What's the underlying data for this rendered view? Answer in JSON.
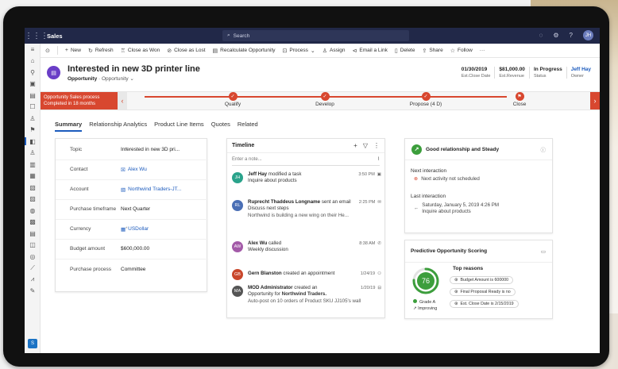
{
  "topbar": {
    "app_name": "Sales",
    "search_placeholder": "Search",
    "avatar_initials": "JH"
  },
  "command_bar": {
    "new": "New",
    "refresh": "Refresh",
    "close_won": "Close as Won",
    "close_lost": "Close as Lost",
    "recalculate": "Recalculate Opportunity",
    "process": "Process",
    "assign": "Assign",
    "email_link": "Email a Link",
    "delete": "Delete",
    "share": "Share",
    "follow": "Follow",
    "more": "···"
  },
  "record": {
    "title": "Interested in new 3D printer line",
    "entity": "Opportunity",
    "form": "Opportunity",
    "close_date": "01/30/2019",
    "close_date_label": "Est.Close Date",
    "revenue": "$81,000.00",
    "revenue_label": "Est.Revenue",
    "status": "In Progress",
    "status_label": "Status",
    "owner": "Jeff Hay",
    "owner_label": "Owner"
  },
  "process": {
    "name": "Opportunity Sales process",
    "completed": "Completed in 18 months",
    "stages": [
      "Qualify",
      "Develop",
      "Propose (4 D)",
      "Close"
    ]
  },
  "tabs": [
    "Summary",
    "Relationship Analytics",
    "Product Line Items",
    "Quotes",
    "Related"
  ],
  "summary": {
    "fields": [
      {
        "label": "Topic",
        "value": "Interested in new 3D pri..."
      },
      {
        "label": "Contact",
        "value": "Alex Wu"
      },
      {
        "label": "Account",
        "value": "Northwind Traders-JT..."
      },
      {
        "label": "Purchase timeframe",
        "value": "Next Quarter"
      },
      {
        "label": "Currency",
        "value": "USDollar"
      },
      {
        "label": "Budget amount",
        "value": "$600,000.00"
      },
      {
        "label": "Purchase process",
        "value": "Committee"
      }
    ],
    "required_marks": [
      "*",
      "*"
    ]
  },
  "timeline": {
    "title": "Timeline",
    "note_placeholder": "Enter a note...",
    "items": [
      {
        "initials": "JH",
        "who": "Jeff Hay",
        "action": " modified a task",
        "detail": "Inquire about products",
        "time": "3:50 PM",
        "color": "#2aa38b"
      },
      {
        "initials": "RL",
        "who": "Ruprecht Thaddeus Longname",
        "action": " sent an email",
        "detail": "Discuss next steps",
        "detail2": "Northwind is building a new wing on their He...",
        "time": "2:25 PM",
        "color": "#4a6fb5"
      },
      {
        "initials": "AW",
        "who": "Alex Wu",
        "action": " called",
        "detail": "Weekly discussion",
        "time": "8:38 AM",
        "color": "#a35aa8"
      },
      {
        "initials": "GB",
        "who": "Gern Blanston",
        "action": " created an appointment",
        "detail": "",
        "time": "1/24/19",
        "color": "#c9472b"
      },
      {
        "initials": "MA",
        "who": "MOD Administrator",
        "action": " created an",
        "detail_pre": "Opportunity for ",
        "detail_bold": "Northwind Traders.",
        "detail2": "Auto-post on 10 orders of Product SKU JJ105's wall",
        "time": "1/20/19",
        "color": "#555555"
      }
    ]
  },
  "relationship": {
    "headline": "Good relationship and Steady",
    "next_title": "Next interaction",
    "next_value": "Next activity not scheduled",
    "last_title": "Last interaction",
    "last_date": "Saturday, January 5, 2019 4:26 PM",
    "last_value": "Inquire about products"
  },
  "scoring": {
    "title": "Predictive Opportunity Scoring",
    "score": "76",
    "grade": "Grade A",
    "trend": "Improving",
    "reasons_title": "Top reasons",
    "reasons": [
      "Budget Amount is 600000",
      "Final Proposal Ready is no",
      "Est. Close Date is 2/15/2019"
    ]
  },
  "colors": {
    "accent": "#d8472f",
    "brand": "#212848",
    "link": "#1c5bbd",
    "good": "#3c9e3c"
  },
  "nav_badge": "S"
}
